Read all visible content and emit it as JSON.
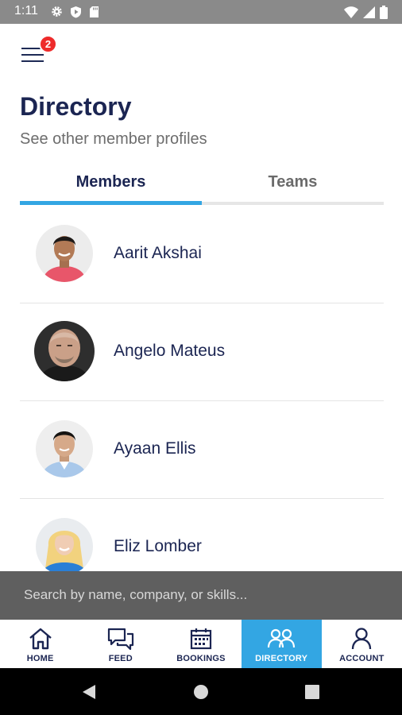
{
  "status_bar": {
    "time": "1:11",
    "left_icons": [
      "gear-icon",
      "shield-play-icon",
      "sd-card-icon"
    ],
    "right_icons": [
      "wifi-icon",
      "cell-signal-icon",
      "battery-icon"
    ]
  },
  "header": {
    "menu_icon": "hamburger-menu-icon",
    "badge_count": "2",
    "title": "Directory",
    "subtitle": "See other member profiles"
  },
  "tabs": [
    {
      "label": "Members",
      "active": true
    },
    {
      "label": "Teams",
      "active": false
    }
  ],
  "members": [
    {
      "name": "Aarit Akshai"
    },
    {
      "name": "Angelo Mateus"
    },
    {
      "name": "Ayaan Ellis"
    },
    {
      "name": "Eliz Lomber"
    }
  ],
  "search": {
    "placeholder": "Search by name, company, or skills...",
    "value": ""
  },
  "bottom_nav": [
    {
      "label": "HOME",
      "icon": "home-icon",
      "active": false
    },
    {
      "label": "FEED",
      "icon": "chat-bubbles-icon",
      "active": false
    },
    {
      "label": "BOOKINGS",
      "icon": "calendar-icon",
      "active": false
    },
    {
      "label": "DIRECTORY",
      "icon": "people-icon",
      "active": true
    },
    {
      "label": "ACCOUNT",
      "icon": "person-icon",
      "active": false
    }
  ],
  "colors": {
    "accent": "#33a6e3",
    "title": "#1b2552",
    "badge": "#ee2b2b",
    "search_bar": "#5f5f5f",
    "status_bar": "#8a8a8a"
  }
}
